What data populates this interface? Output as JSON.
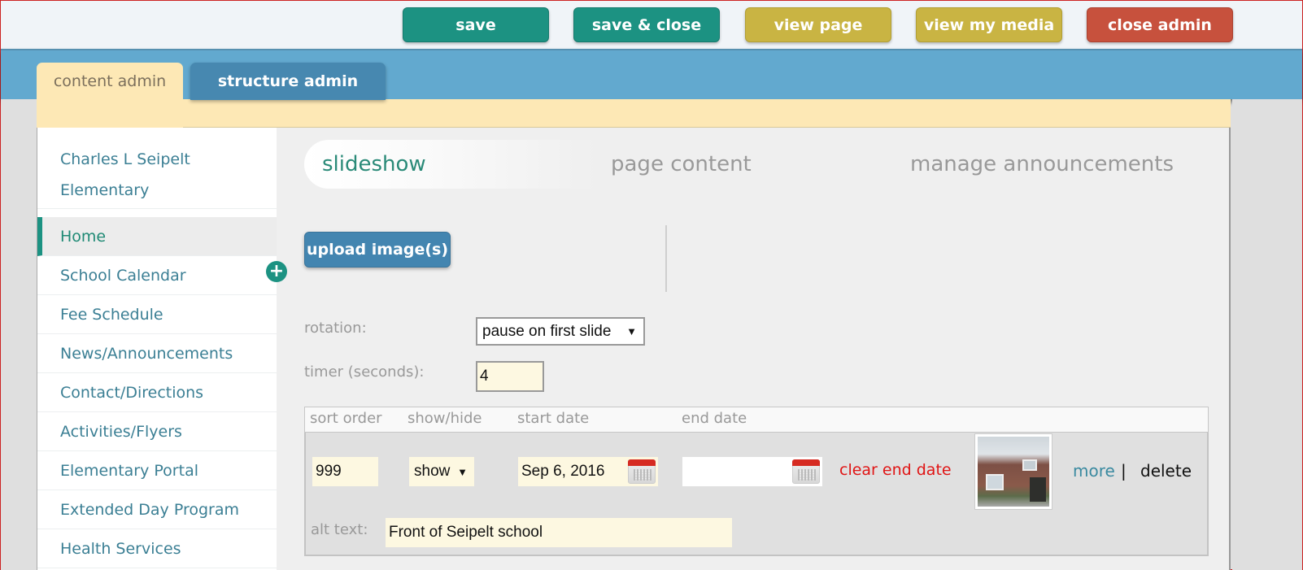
{
  "toolbar": {
    "buttons": [
      {
        "label": "save",
        "color": "#1c9282"
      },
      {
        "label": "save & close",
        "color": "#1c9282"
      },
      {
        "label": "view page",
        "color": "#c9b443"
      },
      {
        "label": "view my media",
        "color": "#c9b443"
      },
      {
        "label": "close admin",
        "color": "#c7513d"
      }
    ]
  },
  "admin_tabs": [
    {
      "label": "content admin",
      "active": true
    },
    {
      "label": "structure admin",
      "active": false
    }
  ],
  "sidebar": {
    "title": "Charles L Seipelt Elementary",
    "items": [
      {
        "label": "Home",
        "active": true
      },
      {
        "label": "School Calendar",
        "icon": "plus-circle-icon"
      },
      {
        "label": "Fee Schedule"
      },
      {
        "label": "News/Announcements"
      },
      {
        "label": "Contact/Directions"
      },
      {
        "label": "Activities/Flyers"
      },
      {
        "label": "Elementary Portal"
      },
      {
        "label": "Extended Day Program"
      },
      {
        "label": "Health Services"
      }
    ]
  },
  "subtabs": [
    {
      "label": "slideshow",
      "active": true
    },
    {
      "label": "page content"
    },
    {
      "label": "manage announcements"
    }
  ],
  "slideshow": {
    "upload_label": "upload image(s)",
    "rotation_label": "rotation:",
    "rotation_value": "pause on first slide",
    "timer_label": "timer (seconds):",
    "timer_value": "4",
    "table": {
      "headers": [
        "sort order",
        "show/hide",
        "start date",
        "end date"
      ],
      "rows": [
        {
          "sort_order": "999",
          "show_hide": "show",
          "start_date": "Sep 6, 2016",
          "end_date": "",
          "clear_end_date": "clear end date",
          "thumbnail": "school-building-photo",
          "more": "more",
          "separator": "|",
          "delete": "delete",
          "alt_label": "alt text:",
          "alt_text": "Front of Seipelt school"
        }
      ]
    }
  },
  "colors": {
    "accent_teal": "#1c9282",
    "header_blue": "#62a9cf",
    "cream": "#fde8b5",
    "link_red": "#e01515"
  }
}
